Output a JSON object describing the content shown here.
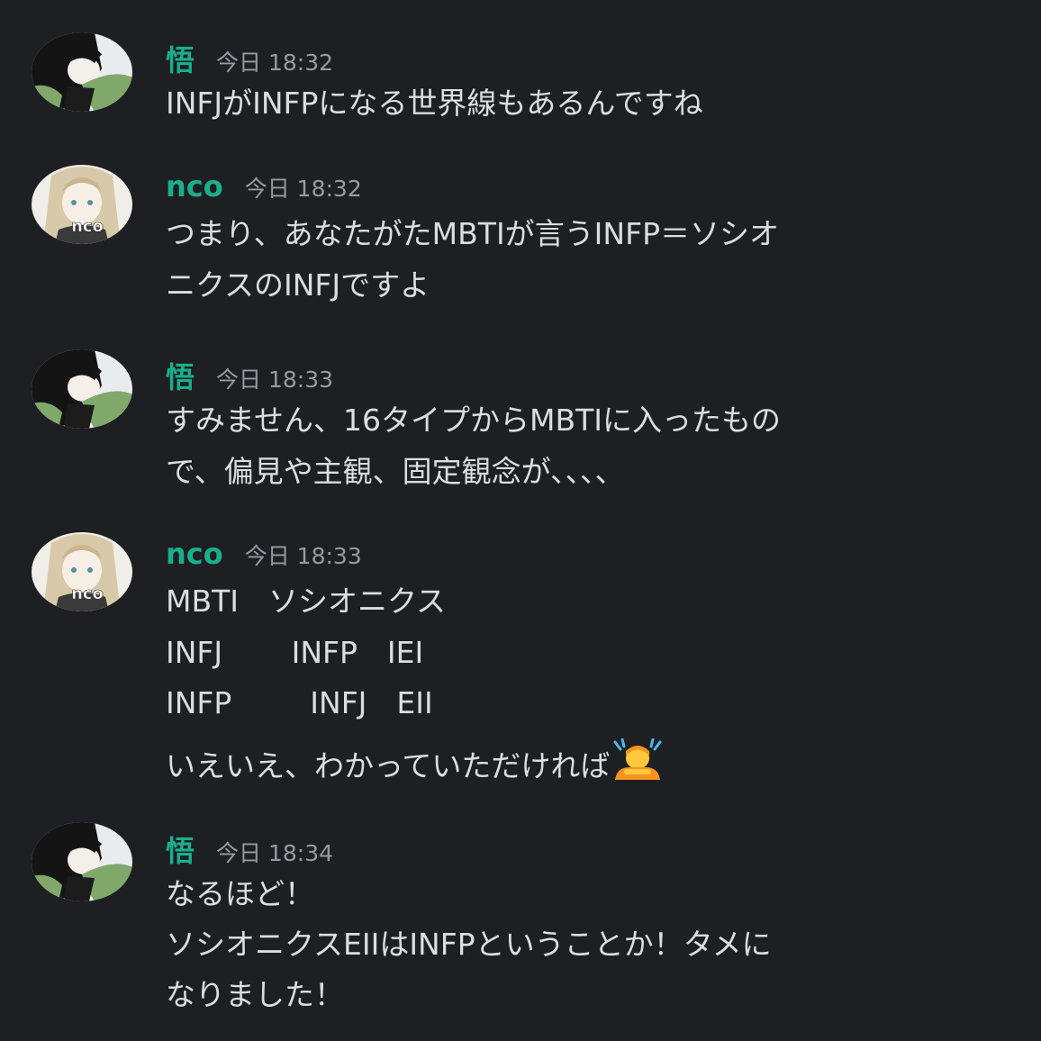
{
  "messages": [
    {
      "username": "悟",
      "timestamp": "今日 18:32",
      "lines": [
        "INFJがINFPになる世界線もあるんですね"
      ]
    },
    {
      "username": "nco",
      "timestamp": "今日 18:32",
      "avatar_text": "nco",
      "lines": [
        "つまり、あなたがたMBTIが言うINFP＝ソシオ",
        "ニクスのINFJですよ"
      ]
    },
    {
      "username": "悟",
      "timestamp": "今日 18:33",
      "lines": [
        "すみません、16タイプからMBTIに入ったもの",
        "で、偏見や主観、固定観念が、、、、"
      ]
    },
    {
      "username": "nco",
      "timestamp": "今日 18:33",
      "avatar_text": "nco",
      "lines": [
        "MBTI　ソシオニクス",
        "INFJ　　 INFP　IEI",
        "INFP　　  INFJ　EII",
        "いえいえ、わかっていただければ"
      ],
      "emoji": "person-bowing-emoji"
    },
    {
      "username": "悟",
      "timestamp": "今日 18:34",
      "lines": [
        "なるほど！",
        "ソシオニクスEIIはINFPということか！タメに",
        "なりました！"
      ]
    }
  ],
  "colors": {
    "background": "#1e1f22",
    "username": "#1aaf8c",
    "timestamp": "#949ba4",
    "text": "#dbdee1"
  }
}
